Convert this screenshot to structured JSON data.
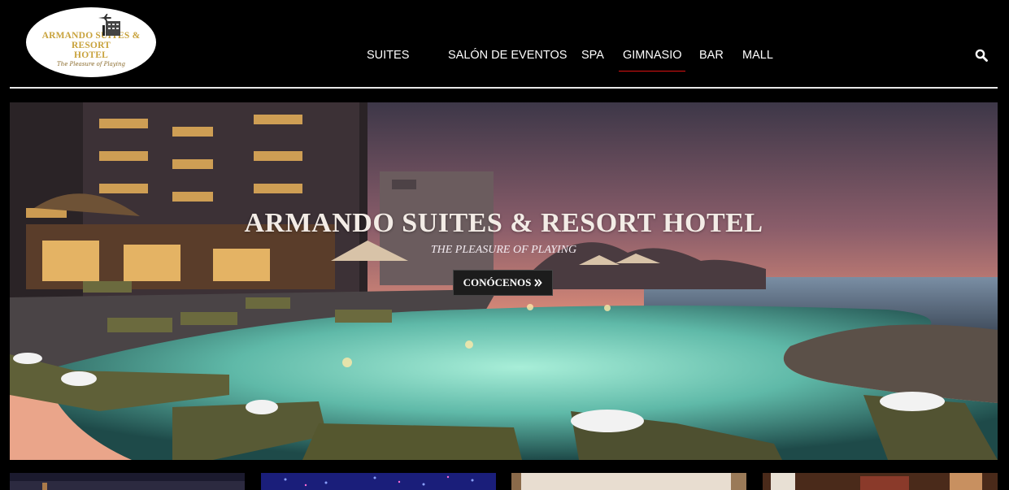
{
  "logo": {
    "name_line1": "ARMANDO SUITES & RESORT",
    "name_line2": "HOTEL",
    "tagline": "The Pleasure of Playing"
  },
  "nav": {
    "items": [
      {
        "label": "SUITES",
        "active": false
      },
      {
        "label": "SALÓN DE EVENTOS",
        "active": false
      },
      {
        "label": "SPA",
        "active": false
      },
      {
        "label": "GIMNASIO",
        "active": true
      },
      {
        "label": "BAR",
        "active": false
      },
      {
        "label": "MALL",
        "active": false
      }
    ],
    "search_icon": "search-icon"
  },
  "hero": {
    "title": "ARMANDO SUITES & RESORT HOTEL",
    "subtitle": "THE PLEASURE OF PLAYING",
    "cta_label": "CONÓCENOS",
    "cta_icon": "double-chevron-right-icon"
  },
  "colors": {
    "background": "#000000",
    "logo_gold": "#c8a23b",
    "active_underline": "#dd1111",
    "sky_top": "#3b3446",
    "sky_glow": "#e9967a",
    "pool": "#7fd6c4"
  },
  "thumbnails": [
    {
      "icon": "night-resort-thumb"
    },
    {
      "icon": "event-lights-thumb"
    },
    {
      "icon": "spa-room-thumb"
    },
    {
      "icon": "restaurant-thumb"
    }
  ]
}
